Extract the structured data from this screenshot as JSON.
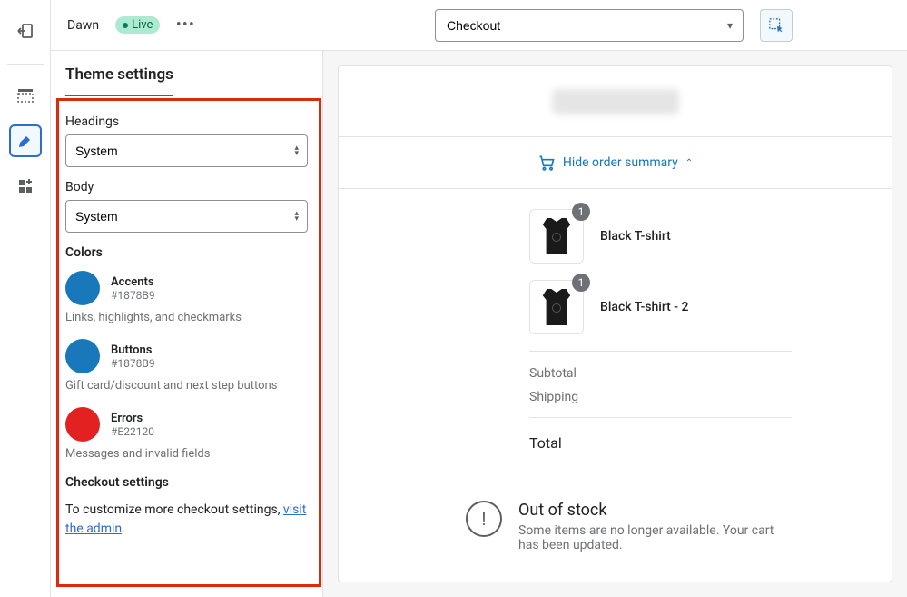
{
  "header": {
    "theme_name": "Dawn",
    "status_badge": "Live",
    "page_selector": "Checkout"
  },
  "sidebar": {
    "title": "Theme settings",
    "headings_label": "Headings",
    "headings_value": "System",
    "body_label": "Body",
    "body_value": "System",
    "colors_heading": "Colors",
    "colors": [
      {
        "name": "Accents",
        "hex": "#1878B9",
        "swatch": "#1878B9",
        "desc": "Links, highlights, and checkmarks"
      },
      {
        "name": "Buttons",
        "hex": "#1878B9",
        "swatch": "#1878B9",
        "desc": "Gift card/discount and next step buttons"
      },
      {
        "name": "Errors",
        "hex": "#E22120",
        "swatch": "#E22120",
        "desc": "Messages and invalid fields"
      }
    ],
    "checkout_heading": "Checkout settings",
    "help_prefix": "To customize more checkout settings, ",
    "help_link": "visit the admin",
    "help_suffix": "."
  },
  "preview": {
    "toggle_label": "Hide order summary",
    "items": [
      {
        "name": "Black T-shirt",
        "qty": "1"
      },
      {
        "name": "Black T-shirt - 2",
        "qty": "1"
      }
    ],
    "subtotal_label": "Subtotal",
    "shipping_label": "Shipping",
    "total_label": "Total",
    "alert_title": "Out of stock",
    "alert_msg": "Some items are no longer available. Your cart has been updated."
  }
}
